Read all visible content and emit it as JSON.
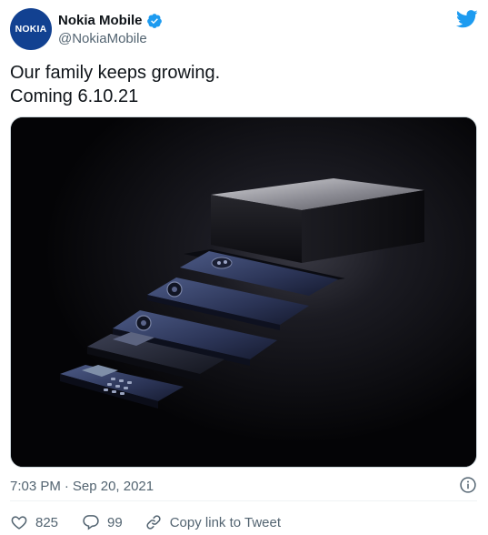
{
  "author": {
    "avatar_text": "NOKIA",
    "display_name": "Nokia Mobile",
    "handle": "@NokiaMobile",
    "verified": true
  },
  "tweet": {
    "lines": [
      "Our family keeps growing.",
      "Coming 6.10.21"
    ]
  },
  "meta": {
    "time": "7:03 PM",
    "separator": "·",
    "date": "Sep 20, 2021"
  },
  "actions": {
    "likes": "825",
    "replies": "99",
    "share_label": "Copy link to Tweet"
  },
  "icons": {
    "brand": "twitter-bird-icon",
    "verified": "verified-badge-icon",
    "info": "info-icon",
    "like": "heart-icon",
    "reply": "reply-bubble-icon",
    "link": "link-icon"
  },
  "colors": {
    "brand_blue": "#1d9bf0",
    "nokia_blue": "#124191",
    "text_primary": "#0f1419",
    "text_secondary": "#536471"
  }
}
